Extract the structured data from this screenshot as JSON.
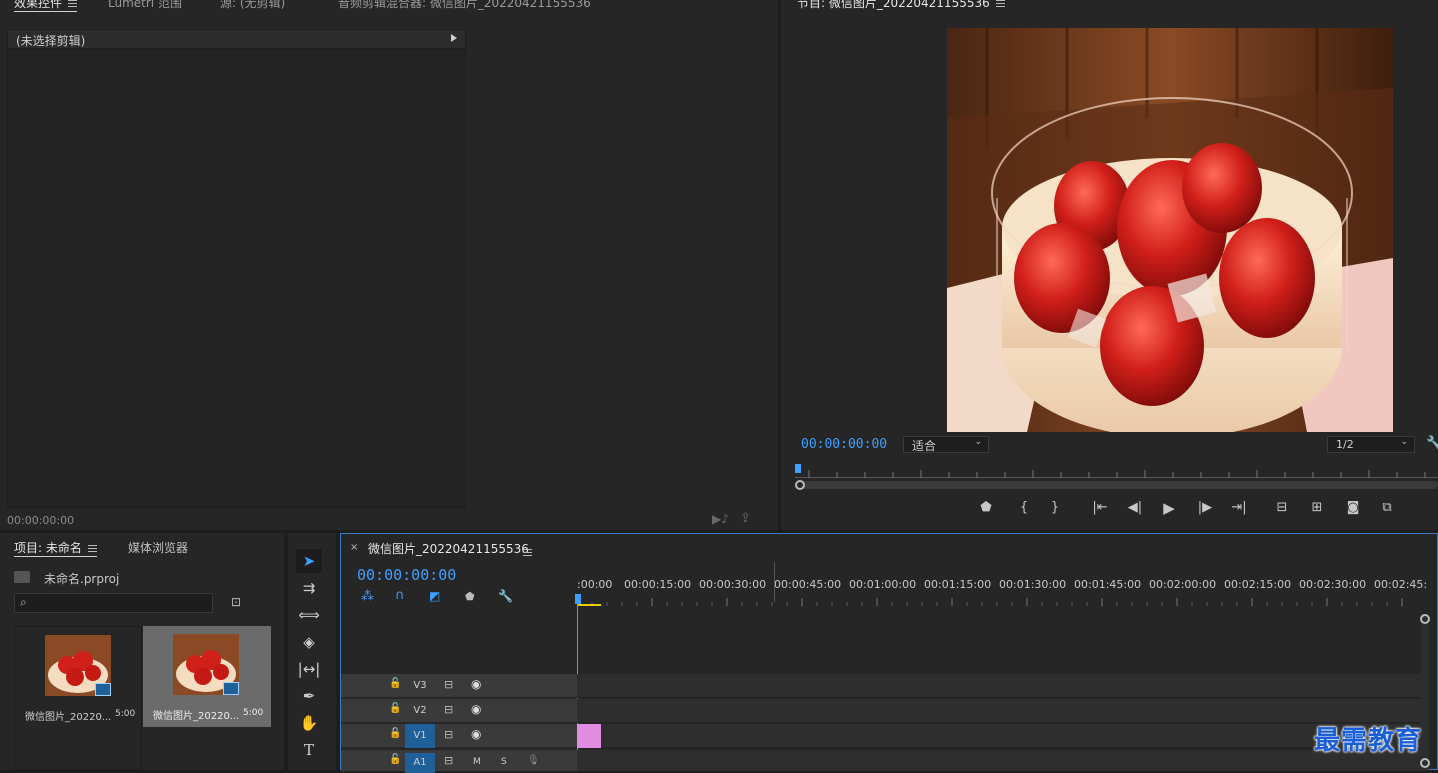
{
  "effect_controls": {
    "tabs": [
      "效果控件",
      "Lumetri 范围",
      "源: (无剪辑)",
      "音频剪辑混合器: 微信图片_20220421155536"
    ],
    "no_clip": "(未选择剪辑)",
    "timecode": "00:00:00:00"
  },
  "program": {
    "title": "节目: 微信图片_20220421155536",
    "timecode": "00:00:00:00",
    "fit_label": "适合",
    "resolution": "1/2"
  },
  "project": {
    "tabs": [
      "项目: 未命名",
      "媒体浏览器"
    ],
    "file_name": "未命名.prproj",
    "items": [
      {
        "name": "微信图片_20220...",
        "duration": "5:00"
      },
      {
        "name": "微信图片_20220...",
        "duration": "5:00"
      }
    ]
  },
  "timeline": {
    "title": "微信图片_20220421155536",
    "timecode": "00:00:00:00",
    "ruler": [
      ":00:00",
      "00:00:15:00",
      "00:00:30:00",
      "00:00:45:00",
      "00:01:00:00",
      "00:01:15:00",
      "00:01:30:00",
      "00:01:45:00",
      "00:02:00:00",
      "00:02:15:00",
      "00:02:30:00",
      "00:02:45:"
    ],
    "tracks": [
      {
        "label": "V3",
        "active": false
      },
      {
        "label": "V2",
        "active": false
      },
      {
        "label": "V1",
        "active": true
      },
      {
        "label": "A1",
        "active": true
      }
    ],
    "audio_m": "M",
    "audio_s": "S",
    "clip_color": "#e08ce0"
  },
  "watermark": "最需教育",
  "colors": {
    "accent": "#3ea0ff",
    "panel": "#262626",
    "active_track": "#1f5f9a"
  }
}
